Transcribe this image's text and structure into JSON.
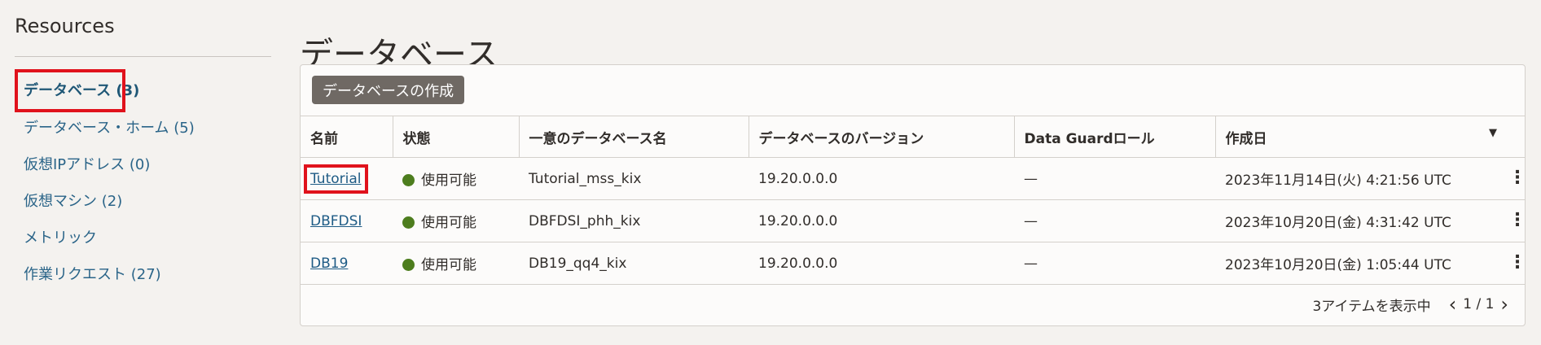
{
  "sidebar": {
    "title": "Resources",
    "items": [
      {
        "label": "データベース (3)"
      },
      {
        "label": "データベース・ホーム (5)"
      },
      {
        "label": "仮想IPアドレス (0)"
      },
      {
        "label": "仮想マシン (2)"
      },
      {
        "label": "メトリック"
      },
      {
        "label": "作業リクエスト (27)"
      }
    ]
  },
  "page": {
    "title": "データベース"
  },
  "toolbar": {
    "create_label": "データベースの作成"
  },
  "table": {
    "columns": [
      "名前",
      "状態",
      "一意のデータベース名",
      "データベースのバージョン",
      "Data Guardロール",
      "作成日"
    ],
    "rows": [
      {
        "name": "Tutorial",
        "state": "使用可能",
        "unique_name": "Tutorial_mss_kix",
        "version": "19.20.0.0.0",
        "dg_role": "—",
        "created": "2023年11月14日(火) 4:21:56 UTC"
      },
      {
        "name": "DBFDSI",
        "state": "使用可能",
        "unique_name": "DBFDSI_phh_kix",
        "version": "19.20.0.0.0",
        "dg_role": "—",
        "created": "2023年10月20日(金) 4:31:42 UTC"
      },
      {
        "name": "DB19",
        "state": "使用可能",
        "unique_name": "DB19_qq4_kix",
        "version": "19.20.0.0.0",
        "dg_role": "—",
        "created": "2023年10月20日(金) 1:05:44 UTC"
      }
    ],
    "status_color": "#4d7d1e"
  },
  "pagination": {
    "summary": "3アイテムを表示中",
    "page": "1 / 1"
  },
  "icons": {
    "sort": "sort-caret-down-icon",
    "row_menu": "kebab-menu-icon",
    "prev": "chevron-left-icon",
    "next": "chevron-right-icon",
    "status": "status-dot-icon"
  },
  "colors": {
    "accent_link": "#1e5b85",
    "highlight": "#e0121c",
    "button_bg": "#6f6964"
  }
}
